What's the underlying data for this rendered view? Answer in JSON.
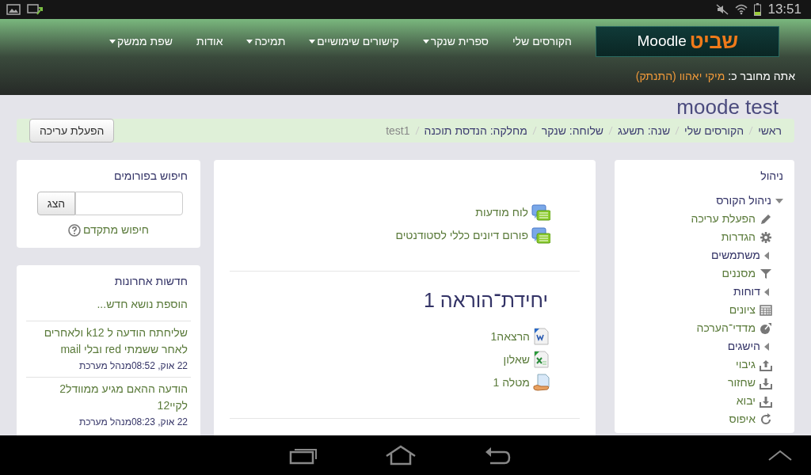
{
  "status_bar": {
    "time": "13:51"
  },
  "header": {
    "logo": {
      "brand": "שביט",
      "product": "Moodle"
    },
    "nav": [
      {
        "label": "הקורסים שלי",
        "has_menu": false
      },
      {
        "label": "ספרית שנקר",
        "has_menu": true
      },
      {
        "label": "קישורים שימושיים",
        "has_menu": true
      },
      {
        "label": "תמיכה",
        "has_menu": true
      },
      {
        "label": "אודות",
        "has_menu": false
      },
      {
        "label": "שפת ממשק",
        "has_menu": true
      }
    ],
    "login": {
      "text": "אתה מחובר כ:",
      "user": "מיקי יאהוו",
      "logout": "(התנתק)"
    }
  },
  "page_title": "moode test",
  "breadcrumb": [
    {
      "label": "ראשי",
      "current": false
    },
    {
      "label": "הקורסים שלי",
      "current": false
    },
    {
      "label": "שנה: תשעג",
      "current": false
    },
    {
      "label": "שלוחה: שנקר",
      "current": false
    },
    {
      "label": "מחלקה: הנדסת תוכנה",
      "current": false
    },
    {
      "label": "test1",
      "current": true
    }
  ],
  "edit_button": "הפעלת עריכה",
  "admin_block": {
    "title": "ניהול",
    "tree": [
      {
        "label": "ניהול הקורס",
        "kind": "branch",
        "expanded": true,
        "children": [
          {
            "label": "הפעלת עריכה",
            "kind": "link"
          },
          {
            "label": "הגדרות",
            "kind": "link"
          },
          {
            "label": "משתמשים",
            "kind": "branch",
            "expanded": false
          },
          {
            "label": "מסננים",
            "kind": "link"
          },
          {
            "label": "דוחות",
            "kind": "branch",
            "expanded": false
          },
          {
            "label": "ציונים",
            "kind": "link"
          },
          {
            "label": "מדדי־הערכה",
            "kind": "link"
          },
          {
            "label": "הישגים",
            "kind": "branch",
            "expanded": false
          },
          {
            "label": "גיבוי",
            "kind": "link"
          },
          {
            "label": "שחזור",
            "kind": "link"
          },
          {
            "label": "יבוא",
            "kind": "link"
          },
          {
            "label": "איפוס",
            "kind": "link"
          }
        ]
      }
    ]
  },
  "course": {
    "forums": [
      {
        "label": "לוח מודעות"
      },
      {
        "label": "פורום דיונים כללי לסטודנטים"
      }
    ],
    "section": {
      "title": "יחידת־הוראה 1",
      "activities": [
        {
          "label": "הרצאה1",
          "kind": "word"
        },
        {
          "label": "שאלון",
          "kind": "excel"
        },
        {
          "label": "מטלה 1",
          "kind": "assignment"
        }
      ]
    }
  },
  "forum_search": {
    "title": "חיפוש בפורומים",
    "button": "הצג",
    "advanced": "חיפוש מתקדם"
  },
  "news": {
    "title": "חדשות אחרונות",
    "add": "הוספת נושא חדש...",
    "items": [
      {
        "title": "שליחתח הודעה ל k12 ולאחרים לאחר ששמתי red ובלי mail",
        "date": "22 אוק, 08:52",
        "author": "מנהל מערכת"
      },
      {
        "title": "הודעה ההאם מגיע ממוודל2 לקיי12",
        "date": "22 אוק, 08:23",
        "author": "מנהל מערכת"
      }
    ]
  }
}
